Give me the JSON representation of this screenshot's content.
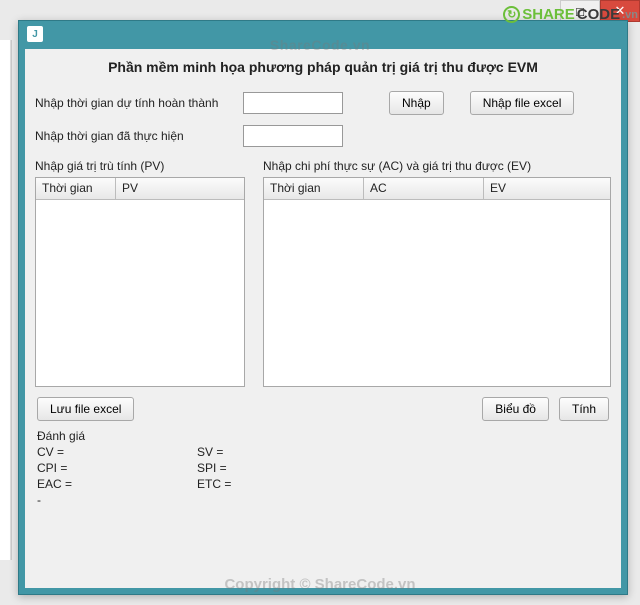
{
  "outer": {
    "maximize_glyph": "□",
    "close_glyph": "✕"
  },
  "window": {
    "java_icon_letter": "J",
    "heading": "Phần mềm minh họa phương pháp quản trị giá trị thu được EVM"
  },
  "form": {
    "label_estimated_time": "Nhập thời gian dự tính hoàn thành",
    "label_actual_time": "Nhập thời gian đã thực hiện",
    "input_estimated_value": "",
    "input_actual_value": "",
    "btn_enter": "Nhập",
    "btn_import_excel": "Nhập file excel"
  },
  "left_table": {
    "caption": "Nhập giá trị trù tính (PV)",
    "col_time": "Thời gian",
    "col_pv": "PV"
  },
  "right_table": {
    "caption": "Nhập chi phí thực sự (AC) và giá trị thu được (EV)",
    "col_time": "Thời gian",
    "col_ac": "AC",
    "col_ev": "EV"
  },
  "actions": {
    "btn_save_excel": "Lưu file excel",
    "btn_chart": "Biểu đồ",
    "btn_calc": "Tính"
  },
  "evaluation": {
    "title": "Đánh giá",
    "cv": "CV =",
    "sv": "SV =",
    "cpi": "CPI =",
    "spi": "SPI =",
    "eac": "EAC =",
    "etc": "ETC =",
    "extra": "-"
  },
  "watermark": {
    "brand_share": "SHARE",
    "brand_code": "CODE",
    "brand_vn": ".vn",
    "center": "ShareCode.vn",
    "bottom": "Copyright © ShareCode.vn"
  }
}
